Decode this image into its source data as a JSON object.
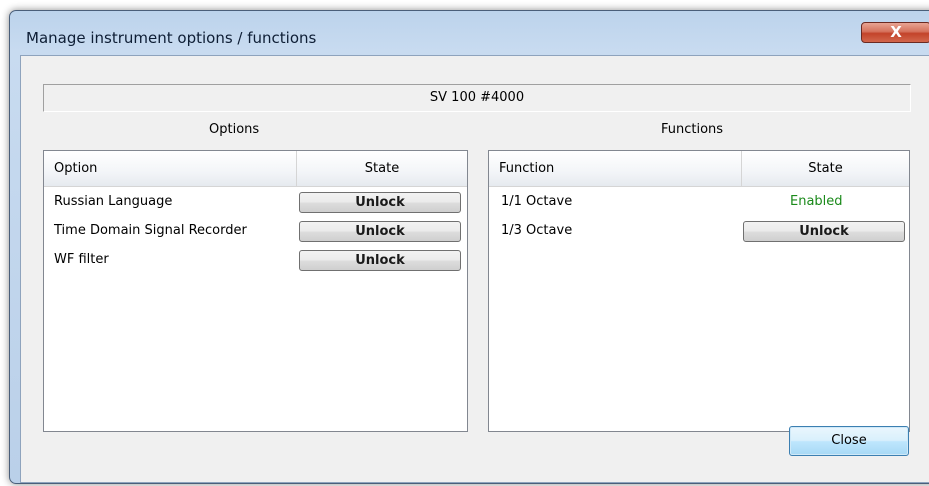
{
  "window": {
    "title": "Manage instrument options / functions",
    "close_glyph": "X"
  },
  "device": {
    "name": "SV 100 #4000"
  },
  "options": {
    "group_title": "Options",
    "columns": [
      "Option",
      "State"
    ],
    "rows": [
      {
        "name": "Russian Language",
        "state": "Unlock"
      },
      {
        "name": "Time Domain Signal Recorder",
        "state": "Unlock"
      },
      {
        "name": "WF filter",
        "state": "Unlock"
      }
    ]
  },
  "functions": {
    "group_title": "Functions",
    "columns": [
      "Function",
      "State"
    ],
    "rows": [
      {
        "name": "1/1 Octave",
        "state": "Enabled"
      },
      {
        "name": "1/3 Octave",
        "state": "Unlock"
      }
    ]
  },
  "footer": {
    "close_label": "Close"
  },
  "colors": {
    "enabled": "#1a8a1a",
    "accent": "#3c7fb1",
    "title_bar": "#bcd3ec"
  }
}
